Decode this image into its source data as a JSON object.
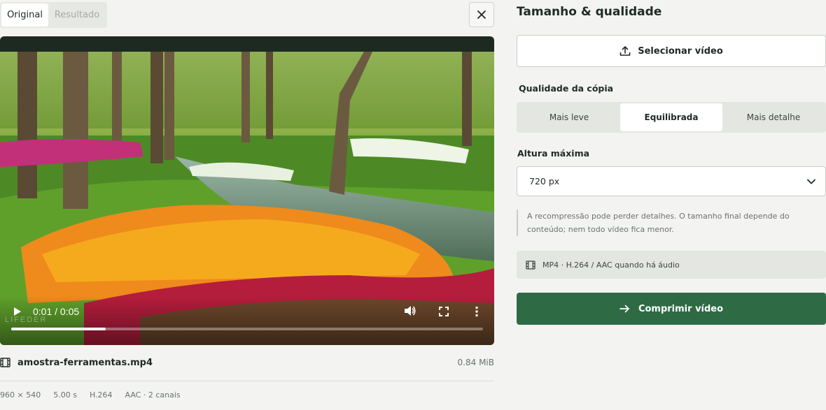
{
  "tabs": [
    {
      "label": "Original",
      "active": true
    },
    {
      "label": "Resultado",
      "active": false
    }
  ],
  "player": {
    "time": "0:01 / 0:05",
    "watermark": "LIFEDER",
    "progress": 0.2
  },
  "file": {
    "name": "amostra-ferramentas.mp4",
    "size": "0.84 MiB",
    "meta": [
      "960 × 540",
      "5.00 s",
      "H.264",
      "AAC · 2 canais"
    ]
  },
  "panel": {
    "title": "Tamanho & qualidade",
    "select_video_label": "Selecionar vídeo",
    "quality_label": "Qualidade da cópia",
    "quality_options": [
      "Mais leve",
      "Equilibrada",
      "Mais detalhe"
    ],
    "quality_selected": "Equilibrada",
    "height_label": "Altura máxima",
    "height_value": "720 px",
    "note": "A recompressão pode perder detalhes. O tamanho final depende do conteúdo; nem todo vídeo fica menor.",
    "format_info": "MP4 · H.264 / AAC quando há áudio",
    "compress_label": "Comprimir vídeo"
  },
  "colors": {
    "accent": "#2e6b45",
    "background": "#f3f4f1"
  },
  "icons": [
    "close-icon",
    "play-icon",
    "volume-icon",
    "fullscreen-icon",
    "more-vert-icon",
    "film-icon",
    "upload-icon",
    "chevron-down-icon",
    "arrow-right-icon"
  ]
}
